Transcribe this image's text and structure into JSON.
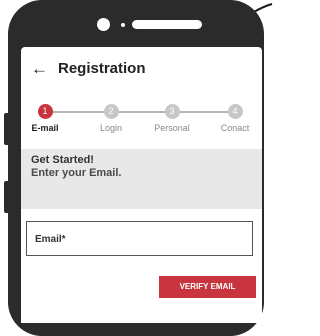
{
  "header": {
    "back_icon": "arrow-left-icon",
    "title": "Registration"
  },
  "stepper": {
    "steps": [
      {
        "number": "1",
        "label": "E-mail",
        "active": true
      },
      {
        "number": "2",
        "label": "Login",
        "active": false
      },
      {
        "number": "3",
        "label": "Personal",
        "active": false
      },
      {
        "number": "4",
        "label": "Conact",
        "active": false
      }
    ]
  },
  "info": {
    "title": "Get Started!",
    "subtitle": "Enter your Email."
  },
  "email_field": {
    "label": "Email*",
    "value": ""
  },
  "verify_button": {
    "label": "VERIFY EMAIL"
  },
  "colors": {
    "accent": "#c8353e",
    "device": "#2b2b2b",
    "info_bg": "#e8e8e8",
    "inactive_step": "#c7c7c7"
  }
}
